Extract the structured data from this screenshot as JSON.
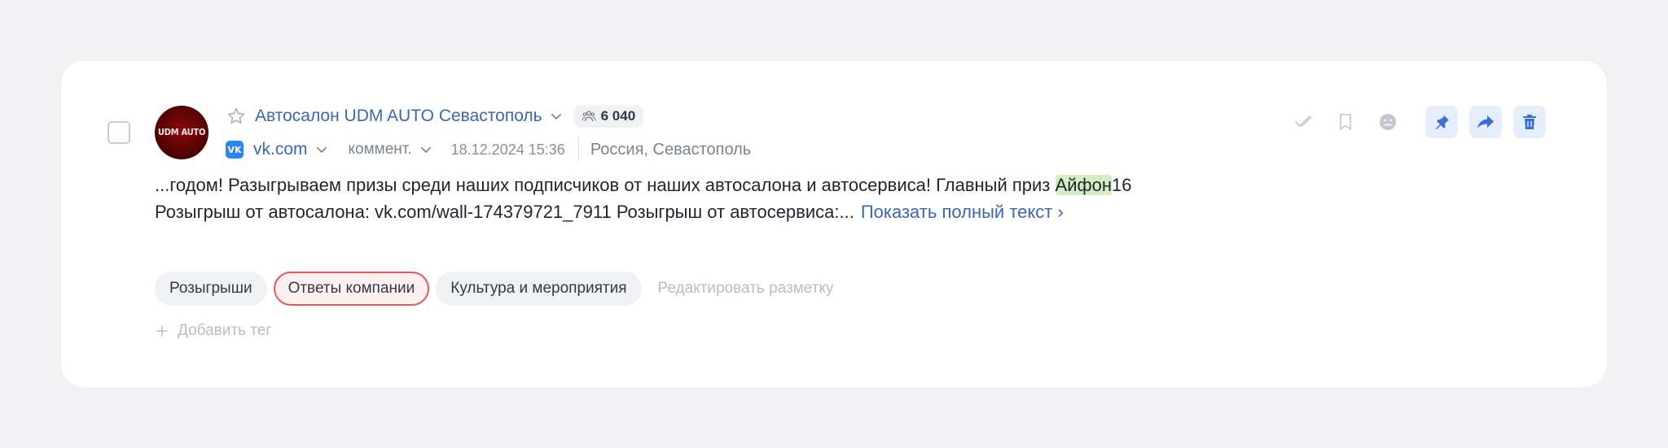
{
  "post": {
    "source_name": "Автосалон UDM AUTO Севастополь",
    "subscribers": "6 040",
    "network": "vk.com",
    "post_type": "коммент.",
    "date": "18.12.2024 15:36",
    "location": "Россия, Севастополь",
    "avatar_text": "UDM AUTO",
    "text_before": "...годом! Разыгрываем призы среди наших подписчиков от наших автосалона и автосервиса! Главный приз ",
    "text_highlight": "Айфон",
    "text_after": "16 Розыгрыш от автосалона: vk.com/wall-174379721_7911 Розыгрыш от автосервиса:...",
    "show_more": "Показать полный текст ›"
  },
  "tags": [
    {
      "label": "Розыгрыши",
      "active": false
    },
    {
      "label": "Ответы компании",
      "active": true
    },
    {
      "label": "Культура и мероприятия",
      "active": false
    }
  ],
  "edit_markup_label": "Редактировать разметку",
  "add_tag_label": "Добавить тег",
  "actions": [
    "check-icon",
    "bookmark-icon",
    "emoji-neutral-icon",
    "pin-icon",
    "share-icon",
    "trash-icon"
  ],
  "colors": {
    "link": "#3a66b5",
    "highlight": "#d4edc2",
    "active_tag_border": "#e45a52",
    "action_fill": "#e6eefb",
    "action_icon": "#3a6fd6"
  }
}
